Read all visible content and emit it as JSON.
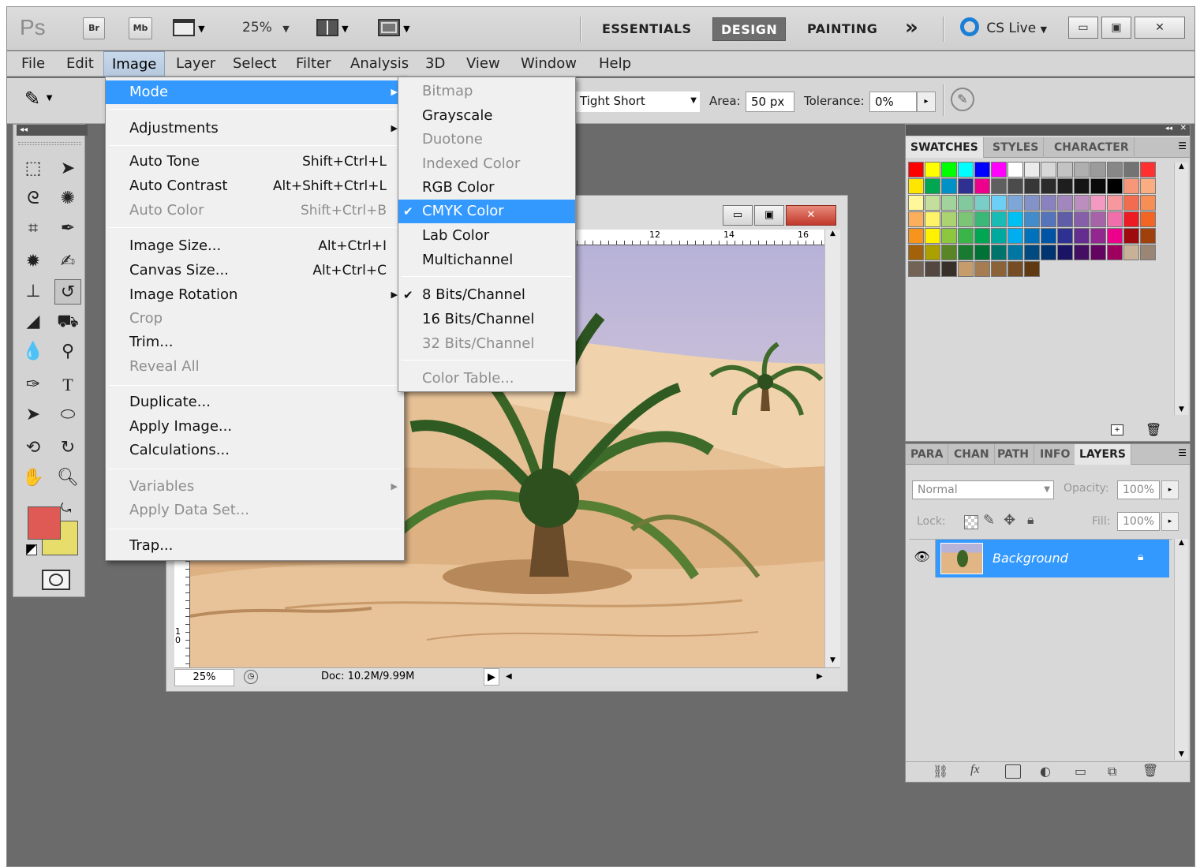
{
  "app": {
    "logo": "Ps",
    "bridge_btn": "Br",
    "minibridge_btn": "Mb",
    "zoom": "25%",
    "workspaces": [
      "ESSENTIALS",
      "DESIGN",
      "PAINTING"
    ],
    "more_label": "»",
    "cslive": "CS Live"
  },
  "menubar": [
    "File",
    "Edit",
    "Image",
    "Layer",
    "Select",
    "Filter",
    "Analysis",
    "3D",
    "View",
    "Window",
    "Help"
  ],
  "options": {
    "sample": "Tight Short",
    "area_label": "Area:",
    "area_value": "50 px",
    "tolerance_label": "Tolerance:",
    "tolerance_value": "0%"
  },
  "image_menu": {
    "mode": "Mode",
    "adjustments": "Adjustments",
    "auto_tone": "Auto Tone",
    "auto_tone_sc": "Shift+Ctrl+L",
    "auto_contrast": "Auto Contrast",
    "auto_contrast_sc": "Alt+Shift+Ctrl+L",
    "auto_color": "Auto Color",
    "auto_color_sc": "Shift+Ctrl+B",
    "image_size": "Image Size...",
    "image_size_sc": "Alt+Ctrl+I",
    "canvas_size": "Canvas Size...",
    "canvas_size_sc": "Alt+Ctrl+C",
    "image_rotation": "Image Rotation",
    "crop": "Crop",
    "trim": "Trim...",
    "reveal_all": "Reveal All",
    "duplicate": "Duplicate...",
    "apply_image": "Apply Image...",
    "calculations": "Calculations...",
    "variables": "Variables",
    "apply_data_set": "Apply Data Set...",
    "trap": "Trap..."
  },
  "mode_menu": {
    "bitmap": "Bitmap",
    "grayscale": "Grayscale",
    "duotone": "Duotone",
    "indexed": "Indexed Color",
    "rgb": "RGB Color",
    "cmyk": "CMYK Color",
    "lab": "Lab Color",
    "multichannel": "Multichannel",
    "bits8": "8 Bits/Channel",
    "bits16": "16 Bits/Channel",
    "bits32": "32 Bits/Channel",
    "color_table": "Color Table..."
  },
  "document": {
    "ruler_marks": [
      "12",
      "14",
      "16"
    ],
    "vruler_mark": "10",
    "zoom": "25%",
    "doc_info": "Doc: 10.2M/9.99M"
  },
  "swatches_panel": {
    "tabs": [
      "SWATCHES",
      "STYLES",
      "CHARACTER"
    ]
  },
  "layers_panel": {
    "tabs": [
      "PARA",
      "CHAN",
      "PATH",
      "INFO",
      "LAYERS"
    ],
    "blend_mode": "Normal",
    "opacity_label": "Opacity:",
    "opacity": "100%",
    "lock_label": "Lock:",
    "fill_label": "Fill:",
    "fill": "100%",
    "layer_name": "Background"
  },
  "colors": {
    "foreground": "#e05a55",
    "background": "#e6dd6a",
    "highlight": "#3399ff"
  }
}
